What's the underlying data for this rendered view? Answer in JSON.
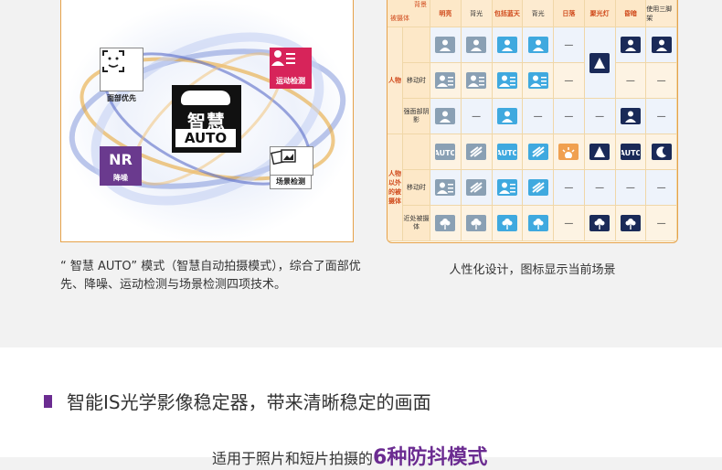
{
  "promo": {
    "badges": {
      "face": "面部优先",
      "motion": "运动检测",
      "nr_big": "NR",
      "nr": "降噪",
      "scene": "场景检测"
    },
    "auto_cn": "智慧",
    "auto_en": "AUTO",
    "caption": "“ 智慧 AUTO” 模式（智慧自动拍摄模式），综合了面部优先、降噪、运动检测与场景检测四项技术。"
  },
  "scene_table": {
    "corner_top": "背景",
    "corner_bottom": "被摄体",
    "col_headers": [
      {
        "top": "明亮",
        "sub": ""
      },
      {
        "top": "",
        "sub": "背光"
      },
      {
        "top": "包括蓝天",
        "sub": ""
      },
      {
        "top": "",
        "sub": "背光"
      },
      {
        "top": "日落",
        "sub": ""
      },
      {
        "top": "聚光灯",
        "sub": ""
      },
      {
        "top": "昏暗",
        "sub": ""
      },
      {
        "top": "",
        "sub": "使用三脚架"
      }
    ],
    "groups": [
      "人物",
      "人物以外的被摄体"
    ],
    "row_labels": [
      "",
      "移动时",
      "强面部阴影",
      "",
      "移动时",
      "近处被摄体"
    ],
    "caption": "人性化设计，图标显示当前场景"
  },
  "section": {
    "title": "智能IS光学影像稳定器，带来清晰稳定的画面",
    "subline_prefix": "适用于照片和短片拍摄的",
    "subline_highlight": "6种防抖模式"
  }
}
